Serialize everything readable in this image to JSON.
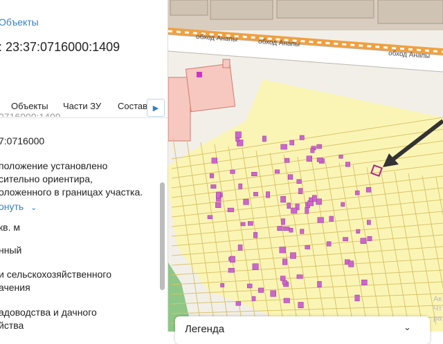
{
  "panel": {
    "top_link": "Объекты",
    "cadastral_title": ": 23:37:0716000:1409",
    "tabs": [
      "Объекты",
      "Части ЗУ",
      "Состав"
    ],
    "cut_text": "0716000:1409",
    "quarter": "7:0716000",
    "location_lines": [
      "положение установлено",
      "сительно ориентира,",
      "оложенного в границах участка."
    ],
    "expand_link": "онуть",
    "area_unit": "кв. м",
    "status": "нный",
    "category_lines": [
      "и сельскохозяйственного",
      "ачения"
    ],
    "usage_lines": [
      "адоводства и дачного",
      "йства"
    ]
  },
  "map": {
    "street_labels": [
      "обход Анапы",
      "обход Анапы",
      "обход Анапы"
    ],
    "highlight_color": "#cc33cc",
    "parcel_fill": "#fbf5b5",
    "railway_color": "#f0a040"
  },
  "legend": {
    "title": "Легенда",
    "chevron": "⌄"
  },
  "watermark": [
    "Ак",
    "Чт",
    "ра"
  ]
}
